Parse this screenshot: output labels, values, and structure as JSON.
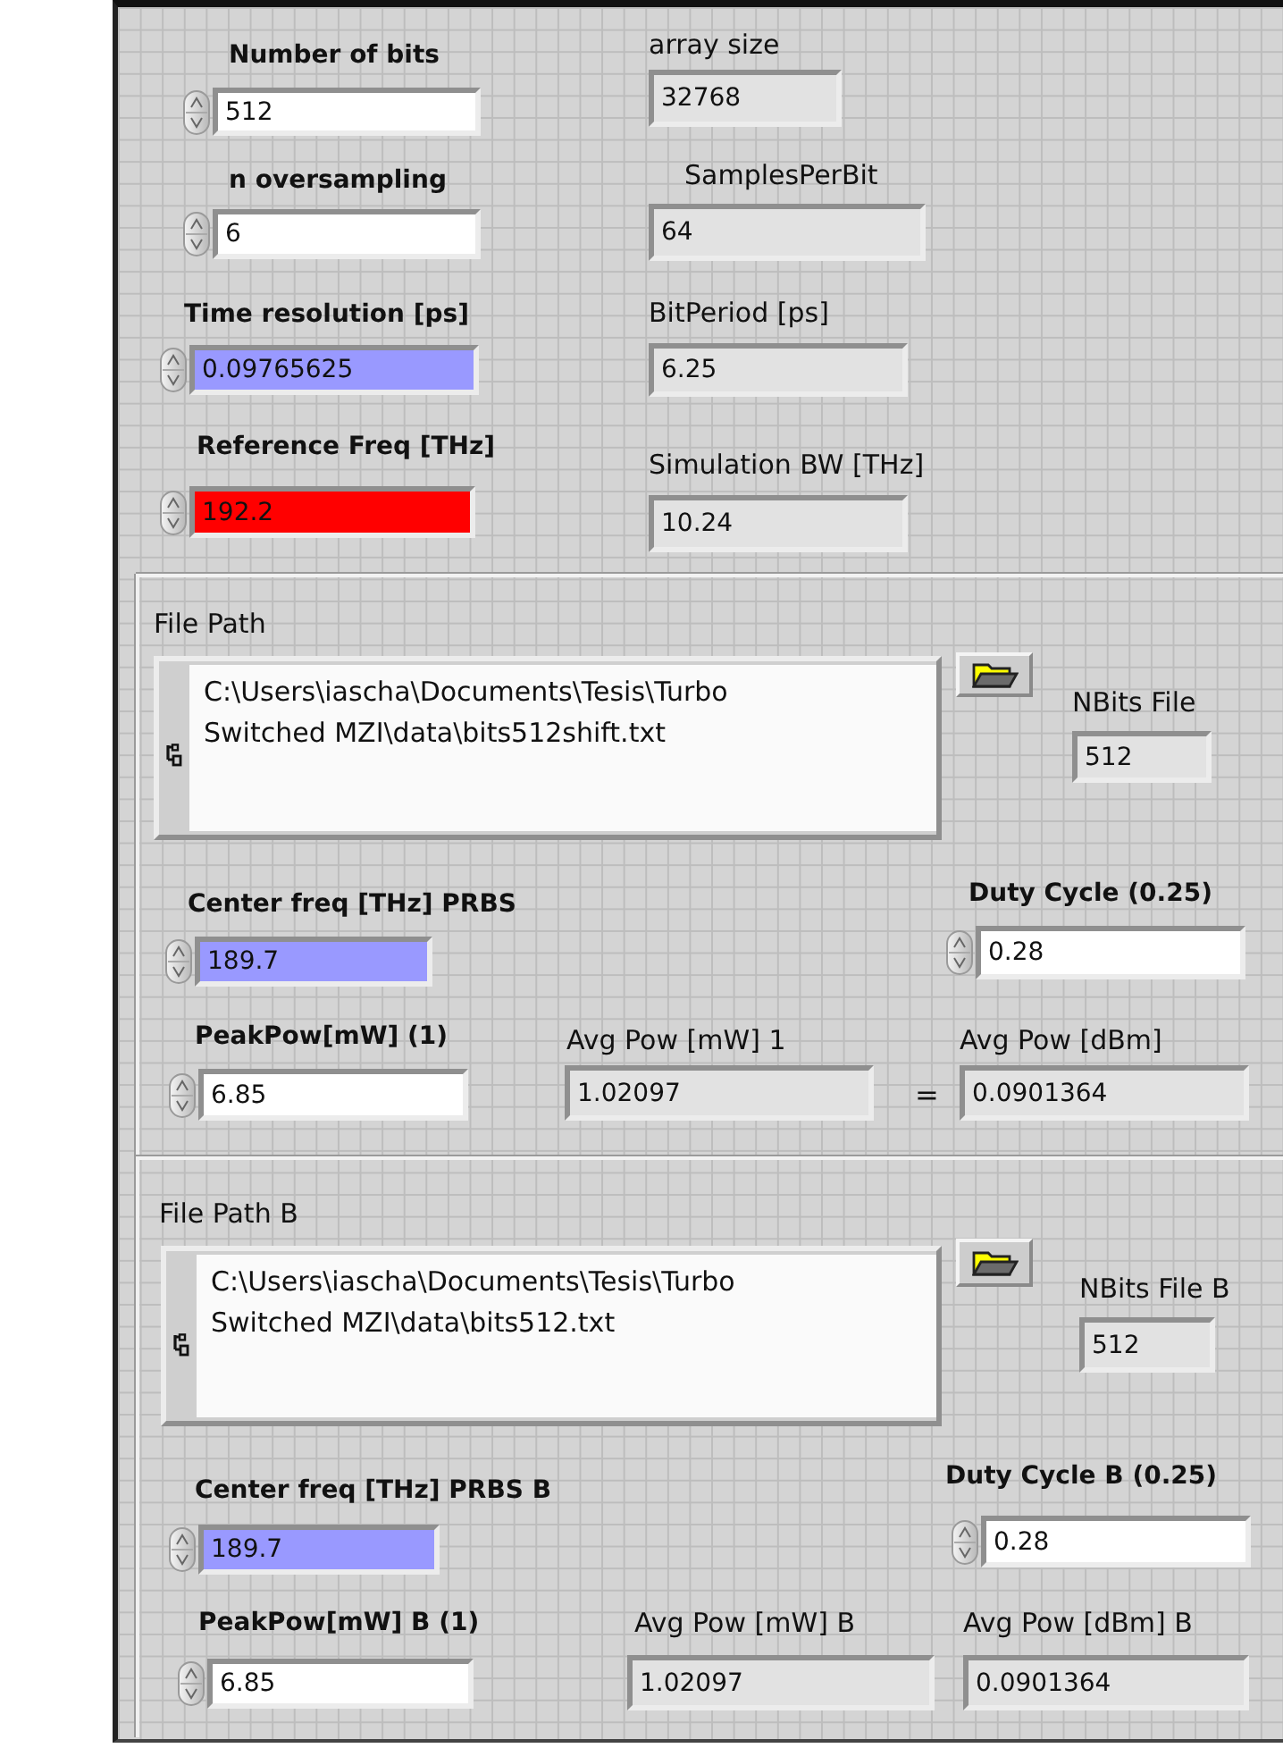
{
  "sections": [
    {
      "kind": "scalars",
      "items": [
        {
          "kind": "control",
          "label": "Number of bits",
          "value": "512",
          "color": "#ffffff"
        },
        {
          "kind": "control",
          "label": "n oversampling",
          "value": "6",
          "color": "#ffffff"
        },
        {
          "kind": "control",
          "label": "Time resolution [ps]",
          "value": "0.09765625",
          "color": "#9999ff"
        },
        {
          "kind": "control",
          "label": "Reference Freq [THz]",
          "value": "192.2",
          "color": "#ff0000"
        },
        {
          "kind": "indicator",
          "label": "array size",
          "value": "32768"
        },
        {
          "kind": "indicator",
          "label": "SamplesPerBit",
          "value": "64"
        },
        {
          "kind": "indicator",
          "label": "BitPeriod [ps]",
          "value": "6.25"
        },
        {
          "kind": "indicator",
          "label": "Simulation BW [THz]",
          "value": "10.24"
        }
      ]
    },
    {
      "kind": "file",
      "items": [
        {
          "kind": "path",
          "label": "File Path",
          "value": "C:\\Users\\iascha\\Documents\\Tesis\\Turbo Switched MZI\\data\\bits512shift.txt"
        },
        {
          "kind": "browse"
        },
        {
          "kind": "indicator",
          "label": "NBits File",
          "value": "512"
        },
        {
          "kind": "control",
          "label": "Center freq [THz] PRBS",
          "value": "189.7",
          "color": "#9999ff"
        },
        {
          "kind": "control",
          "label": "Duty Cycle (0.25)",
          "value": "0.28",
          "color": "#ffffff"
        },
        {
          "kind": "control",
          "label": "PeakPow[mW] (1)",
          "value": "6.85",
          "color": "#ffffff"
        },
        {
          "kind": "indicator",
          "label": "Avg Pow [mW] 1",
          "value": "1.02097"
        },
        {
          "kind": "operator",
          "value": "="
        },
        {
          "kind": "indicator",
          "label": "Avg Pow [dBm]",
          "value": "0.0901364"
        }
      ]
    },
    {
      "kind": "file",
      "items": [
        {
          "kind": "path",
          "label": "File Path B",
          "value": "C:\\Users\\iascha\\Documents\\Tesis\\Turbo Switched MZI\\data\\bits512.txt"
        },
        {
          "kind": "browse"
        },
        {
          "kind": "indicator",
          "label": "NBits File B",
          "value": "512"
        },
        {
          "kind": "control",
          "label": "Center freq [THz] PRBS B",
          "value": "189.7",
          "color": "#9999ff"
        },
        {
          "kind": "control",
          "label": "Duty Cycle B (0.25)",
          "value": "0.28",
          "color": "#ffffff"
        },
        {
          "kind": "control",
          "label": "PeakPow[mW] B (1)",
          "value": "6.85",
          "color": "#ffffff"
        },
        {
          "kind": "indicator",
          "label": "Avg Pow [mW] B",
          "value": "1.02097"
        },
        {
          "kind": "indicator",
          "label": "Avg Pow [dBm] B",
          "value": "0.0901364"
        }
      ]
    }
  ]
}
